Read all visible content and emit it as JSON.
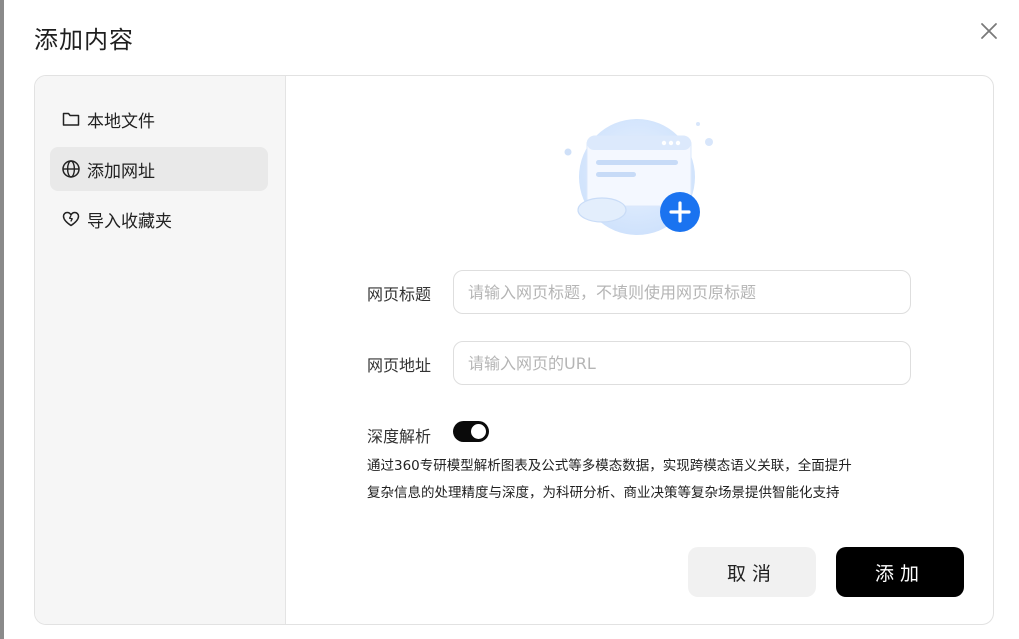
{
  "dialog": {
    "title": "添加内容",
    "close_icon": "close-icon"
  },
  "sidebar": {
    "items": [
      {
        "label": "本地文件",
        "icon": "folder-icon",
        "active": false
      },
      {
        "label": "添加网址",
        "icon": "globe-icon",
        "active": true
      },
      {
        "label": "导入收藏夹",
        "icon": "heart-icon",
        "active": false
      }
    ]
  },
  "form": {
    "title_label": "网页标题",
    "title_placeholder": "请输入网页标题，不填则使用网页原标题",
    "title_value": "",
    "url_label": "网页地址",
    "url_placeholder": "请输入网页的URL",
    "url_value": "",
    "deep_parse_label": "深度解析",
    "deep_parse_on": true,
    "deep_parse_desc_line1": "通过360专研模型解析图表及公式等多模态数据，实现跨模态语义关联，全面提升",
    "deep_parse_desc_line2": "复杂信息的处理精度与深度，为科研分析、商业决策等复杂场景提供智能化支持"
  },
  "buttons": {
    "cancel": "取消",
    "add": "添加"
  },
  "colors": {
    "accent_blue": "#1a73f0",
    "primary_button": "#000000",
    "sidebar_active": "#e9e9e9"
  }
}
